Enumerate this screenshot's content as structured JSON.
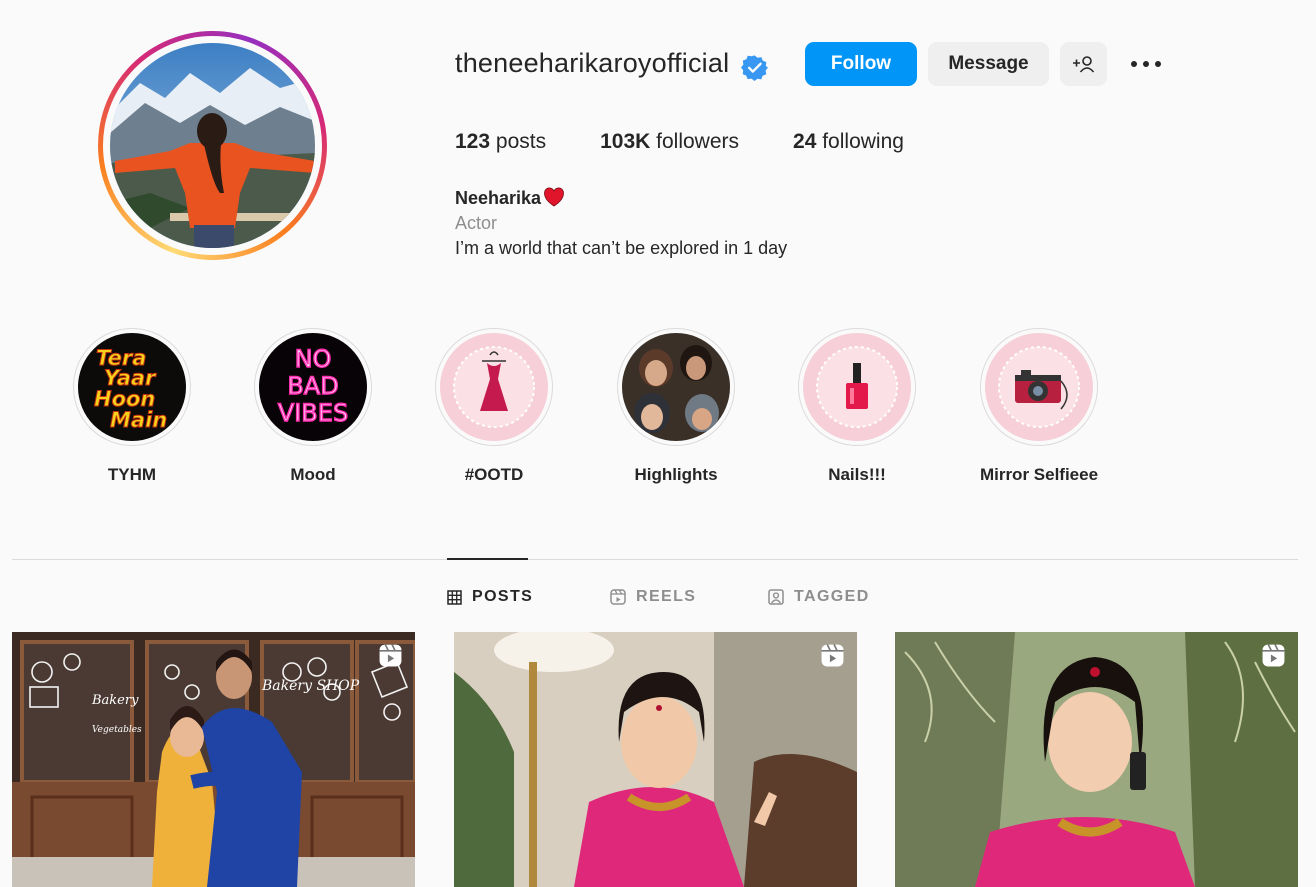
{
  "profile": {
    "username": "theneeharikaroyofficial",
    "verified": true,
    "follow_label": "Follow",
    "message_label": "Message",
    "stats": {
      "posts_count": "123",
      "posts_label": "posts",
      "followers_count": "103K",
      "followers_label": "followers",
      "following_count": "24",
      "following_label": "following"
    },
    "bio": {
      "name": "Neeharika",
      "category": "Actor",
      "text": "I’m a world that can’t be explored in 1 day"
    }
  },
  "highlights": [
    {
      "label": "TYHM",
      "cover_text": [
        "Tera",
        "Yaar",
        "Hoon",
        "Main"
      ]
    },
    {
      "label": "Mood",
      "cover_text": [
        "NO",
        "BAD",
        "VIBES"
      ]
    },
    {
      "label": "#OOTD",
      "cover_icon": "dress-icon"
    },
    {
      "label": "Highlights",
      "cover_icon": "group-photo"
    },
    {
      "label": "Nails!!!",
      "cover_icon": "nail-polish-icon"
    },
    {
      "label": "Mirror Selfieee",
      "cover_icon": "camera-icon"
    }
  ],
  "tabs": [
    {
      "label": "POSTS",
      "icon": "grid-icon",
      "active": true
    },
    {
      "label": "REELS",
      "icon": "reels-icon",
      "active": false
    },
    {
      "label": "TAGGED",
      "icon": "tagged-icon",
      "active": false
    }
  ],
  "posts": [
    {
      "type": "reel",
      "sign_text": "Bakery",
      "sign_text_2": "Bakery SHOP",
      "sign_text_3": "Vegetables"
    },
    {
      "type": "reel"
    },
    {
      "type": "reel"
    }
  ],
  "colors": {
    "accent": "#0095f6",
    "verified": "#3897f0",
    "text": "#262626",
    "muted": "#8e8e8e",
    "background": "#fafafa"
  }
}
